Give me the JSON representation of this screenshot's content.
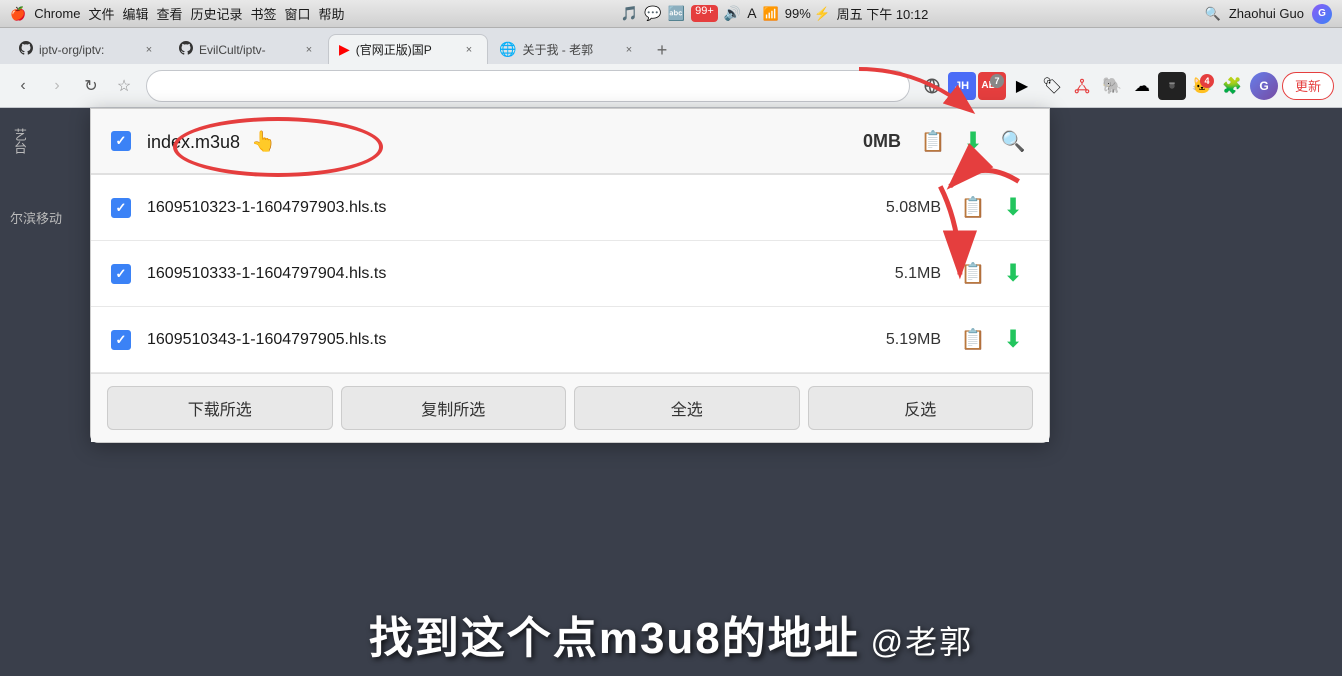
{
  "menubar": {
    "left_icons": [
      "⌘",
      "🎵",
      "💬",
      "🔤",
      "99+",
      "🔊"
    ],
    "center": {
      "wifi": "📶",
      "battery": "99% ⚡",
      "datetime": "周五 下午 10:12"
    },
    "right": {
      "search_icon": "🔍",
      "username": "Zhaohui Guo"
    }
  },
  "tabs": [
    {
      "id": "tab1",
      "icon": "github",
      "title": "iptv-org/iptv:",
      "active": false
    },
    {
      "id": "tab2",
      "icon": "github",
      "title": "EvilCult/iptv-",
      "active": false
    },
    {
      "id": "tab3",
      "icon": "youtube",
      "title": "(官网正版)国P",
      "active": true
    },
    {
      "id": "tab4",
      "icon": "web",
      "title": "关于我 - 老郭",
      "active": false
    }
  ],
  "toolbar": {
    "bookmark_icon": "☆",
    "address": "",
    "extensions": [
      {
        "name": "sphere-ext",
        "icon": "🌐",
        "badge": null
      },
      {
        "name": "jh-ext",
        "icon": "JH",
        "badge": null
      },
      {
        "name": "abp-ext",
        "icon": "ABP",
        "badge": "7"
      },
      {
        "name": "ext4",
        "icon": "▶",
        "badge": null
      },
      {
        "name": "ext5",
        "icon": "🏷",
        "badge": null
      },
      {
        "name": "network-ext",
        "icon": "⬡",
        "badge": null
      },
      {
        "name": "elephant-ext",
        "icon": "🐘",
        "badge": null
      },
      {
        "name": "cloud-ext",
        "icon": "☁",
        "badge": null
      },
      {
        "name": "hls-ext",
        "icon": "📟",
        "badge": null
      },
      {
        "name": "cat-ext",
        "icon": "🐱",
        "badge": "4"
      },
      {
        "name": "puzzle-ext",
        "icon": "🧩",
        "badge": null
      }
    ],
    "update_label": "更新"
  },
  "download_panel": {
    "rows": [
      {
        "checked": true,
        "filename": "index.m3u8",
        "filesize": "0MB",
        "is_header": true
      },
      {
        "checked": true,
        "filename": "1609510323-1-1604797903.hls.ts",
        "filesize": "5.08MB",
        "is_header": false
      },
      {
        "checked": true,
        "filename": "1609510333-1-1604797904.hls.ts",
        "filesize": "5.1MB",
        "is_header": false
      },
      {
        "checked": true,
        "filename": "1609510343-1-1604797905.hls.ts",
        "filesize": "5.19MB",
        "is_header": false
      }
    ],
    "buttons": [
      {
        "id": "download-selected",
        "label": "下载所选"
      },
      {
        "id": "copy-selected",
        "label": "复制所选"
      },
      {
        "id": "select-all",
        "label": "全选"
      },
      {
        "id": "invert",
        "label": "反选"
      }
    ]
  },
  "subtitle": {
    "text": "找到这个点m3u8的地址",
    "author": "@老郭"
  },
  "sidebar": {
    "text": "艺台"
  },
  "page_left": {
    "text": "尔滨移动"
  }
}
